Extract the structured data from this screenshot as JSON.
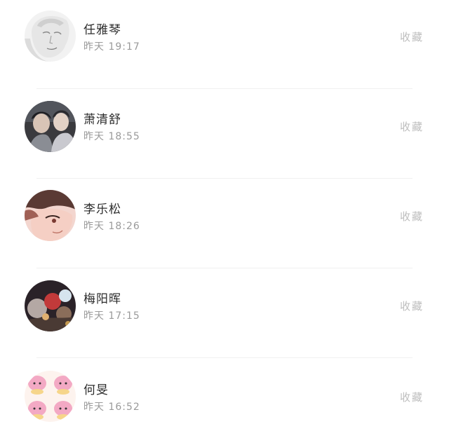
{
  "contacts": [
    {
      "name": "任雅琴",
      "time": "昨天 19:17",
      "action": "收藏",
      "avatar": "sketch-portrait"
    },
    {
      "name": "萧清舒",
      "time": "昨天 18:55",
      "action": "收藏",
      "avatar": "two-people-photo"
    },
    {
      "name": "李乐松",
      "time": "昨天 18:26",
      "action": "收藏",
      "avatar": "anime-face"
    },
    {
      "name": "梅阳晖",
      "time": "昨天 17:15",
      "action": "收藏",
      "avatar": "dark-group-photo"
    },
    {
      "name": "何旻",
      "time": "昨天 16:52",
      "action": "收藏",
      "avatar": "pink-cartoon-grid"
    }
  ]
}
